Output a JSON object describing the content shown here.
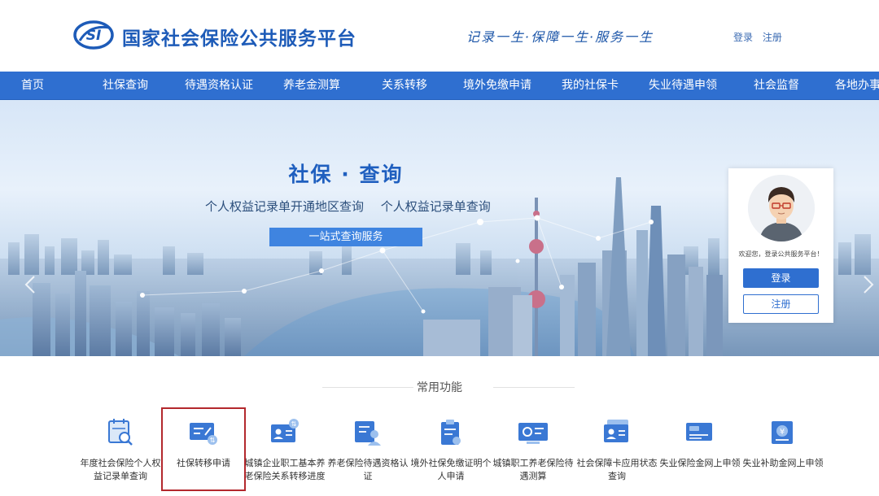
{
  "header": {
    "site_title": "国家社会保险公共服务平台",
    "logo_text": "SI",
    "slogan": "记录一生·保障一生·服务一生",
    "login_link": "登录",
    "register_link": "注册"
  },
  "nav": {
    "items": [
      {
        "label": "首页"
      },
      {
        "label": "社保查询"
      },
      {
        "label": "待遇资格认证"
      },
      {
        "label": "养老金测算"
      },
      {
        "label": "关系转移"
      },
      {
        "label": "境外免缴申请"
      },
      {
        "label": "我的社保卡"
      },
      {
        "label": "失业待遇申领"
      },
      {
        "label": "社会监督"
      },
      {
        "label": "各地办事"
      }
    ]
  },
  "banner": {
    "title": "社保 · 查询",
    "link_1": "个人权益记录单开通地区查询",
    "link_2": "个人权益记录单查询",
    "button": "一站式查询服务"
  },
  "login_card": {
    "welcome": "欢迎您，登录公共服务平台！",
    "login_button": "登录",
    "register_button": "注册"
  },
  "functions": {
    "title": "常用功能",
    "items": [
      {
        "label": "年度社会保险个人权益记录单查询",
        "icon": "calendar-search-icon"
      },
      {
        "label": "社保转移申请",
        "icon": "card-transfer-icon"
      },
      {
        "label": "城镇企业职工基本养老保险关系转移进度",
        "icon": "id-card-transfer-icon"
      },
      {
        "label": "养老保险待遇资格认证",
        "icon": "person-verify-icon"
      },
      {
        "label": "境外社保免缴证明个人申请",
        "icon": "clipboard-certificate-icon"
      },
      {
        "label": "城镇职工养老保险待遇测算",
        "icon": "screen-calculator-icon"
      },
      {
        "label": "社会保障卡应用状态查询",
        "icon": "social-security-card-icon"
      },
      {
        "label": "失业保险金网上申领",
        "icon": "unemployment-card-icon"
      },
      {
        "label": "失业补助金网上申领",
        "icon": "subsidy-document-icon"
      }
    ]
  },
  "colors": {
    "brand_blue": "#2f6fd0",
    "title_blue": "#1d5bb8",
    "highlight_red": "#b3282d"
  }
}
